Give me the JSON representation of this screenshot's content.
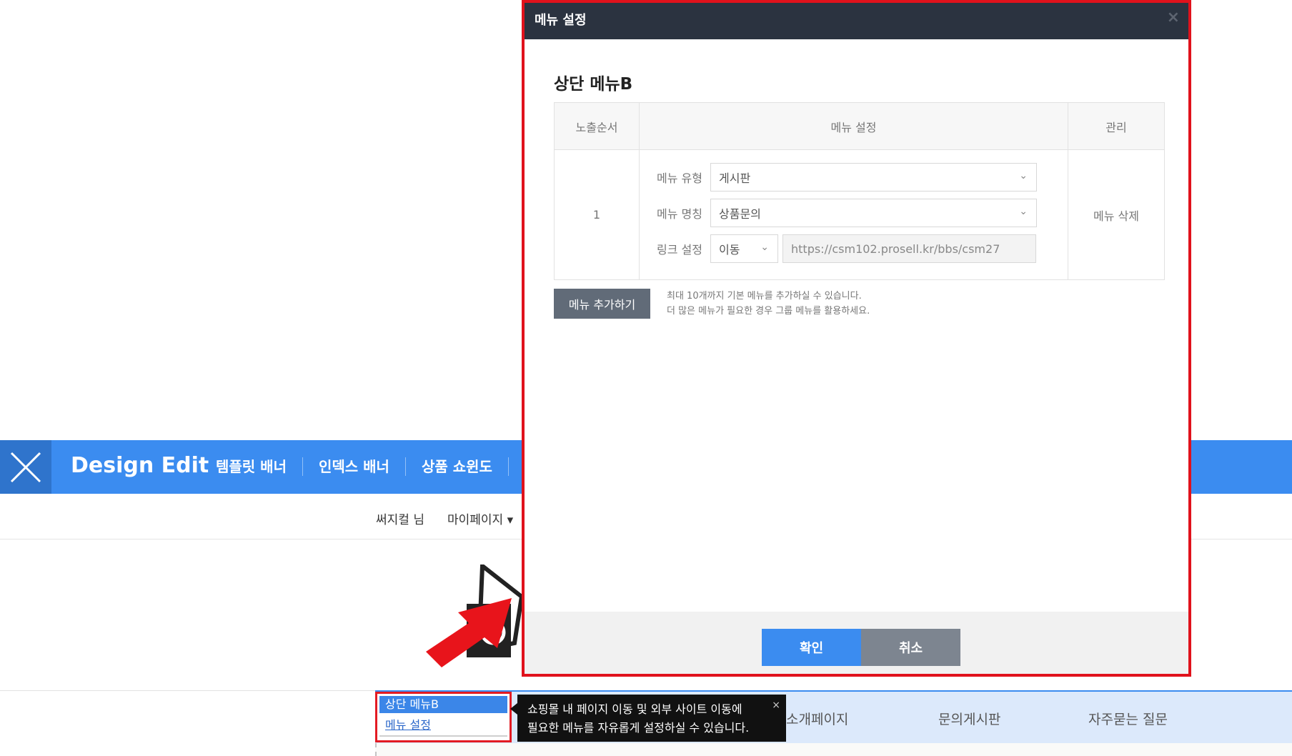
{
  "editor_bar": {
    "brand": "Design Edit",
    "tabs": [
      "템플릿 배너",
      "인덱스 배너",
      "상품 쇼윈도"
    ]
  },
  "user_bar": {
    "username": "써지컬 님",
    "mypage": "마이페이지 ▾"
  },
  "context_menu": {
    "title": "상단 메뉴B",
    "link": "메뉴 설정"
  },
  "tooltip": {
    "line1": "쇼핑몰 내 페이지 이동 및 외부 사이트 이동에",
    "line2": "필요한 메뉴를 자유롭게 설정하실 수 있습니다.",
    "close": "×"
  },
  "menu_items": [
    "소개페이지",
    "문의게시판",
    "자주묻는 질문"
  ],
  "modal": {
    "header_title": "메뉴 설정",
    "close": "×",
    "section_title": "상단 메뉴B",
    "table": {
      "headers": [
        "노출순서",
        "메뉴 설정",
        "관리"
      ],
      "row": {
        "order": "1",
        "fields": {
          "type_label": "메뉴 유형",
          "type_value": "게시판",
          "name_label": "메뉴 명칭",
          "name_value": "상품문의",
          "link_label": "링크 설정",
          "link_mode": "이동",
          "link_url": "https://csm102.prosell.kr/bbs/csm27"
        },
        "manage": "메뉴 삭제"
      }
    },
    "add_button": "메뉴 추가하기",
    "note_line1": "최대 10개까지 기본 메뉴를 추가하실 수 있습니다.",
    "note_line2": "더 많은 메뉴가 필요한 경우 그룹 메뉴를 활용하세요.",
    "ok": "확인",
    "cancel": "취소"
  },
  "colors": {
    "accent": "#3b8cf0",
    "highlight": "#e0121c",
    "modal_header": "#2b3340"
  }
}
